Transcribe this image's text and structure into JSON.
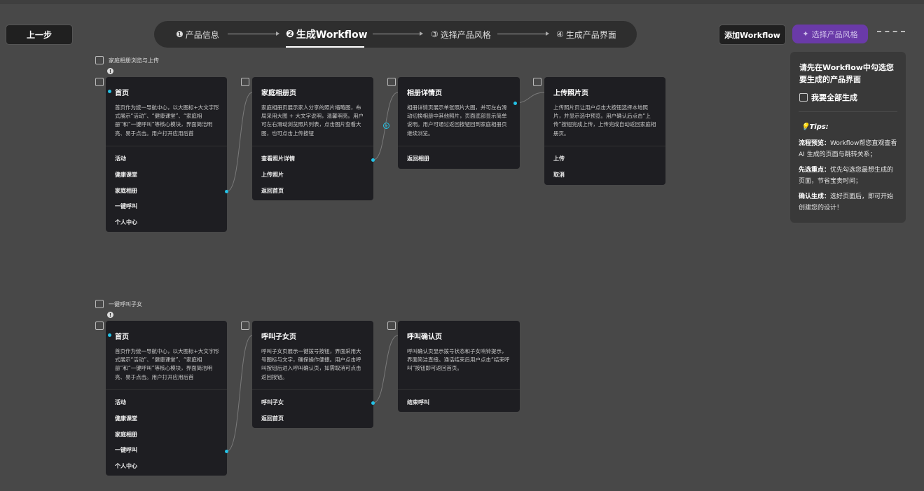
{
  "header": {
    "back_label": "上一步",
    "steps": [
      {
        "num": "❶",
        "label": "产品信息"
      },
      {
        "num": "❷",
        "label": "生成Workflow"
      },
      {
        "num": "③",
        "label": "选择产品风格"
      },
      {
        "num": "④",
        "label": "生成产品界面"
      }
    ],
    "add_workflow_label": "添加Workflow",
    "select_style_label": "选择产品风格",
    "select_style_icon": "sparkle-icon"
  },
  "groups": [
    {
      "label": "家庭相册浏览与上传",
      "cards": [
        {
          "title": "首页",
          "desc": "首页作为统一导航中心，以大图标+大文字形式展示“活动”、“健康课堂”、“家庭相册”和“一键呼叫”等核心模块，界面简洁明亮、易于点击。用户打开应用后首",
          "actions": [
            "活动",
            "健康课堂",
            "家庭相册",
            "一键呼叫",
            "个人中心"
          ]
        },
        {
          "title": "家庭相册页",
          "desc": "家庭相册页展示家人分享的照片缩略图，布局采用大图 + 大文字说明，温馨明亮。用户可左右滑动浏览照片列表，点击图片查看大图，也可点击上传按钮",
          "actions": [
            "查看照片详情",
            "上传照片",
            "返回首页"
          ]
        },
        {
          "title": "相册详情页",
          "desc": "相册详情页展示单张照片大图，并可左右滑动切换相册中其他照片，页面底部显示简单说明。用户可通过返回按钮回到家庭相册页继续浏览。",
          "actions": [
            "返回相册"
          ]
        },
        {
          "title": "上传照片页",
          "desc": "上传照片页让用户点击大按钮选择本地照片，并显示选中预览。用户确认后点击“上传”按钮完成上传，上传完成自动返回家庭相册页。",
          "actions": [
            "上传",
            "取消"
          ]
        }
      ]
    },
    {
      "label": "一键呼叫子女",
      "cards": [
        {
          "title": "首页",
          "desc": "首页作为统一导航中心，以大图标+大文字形式展示“活动”、“健康课堂”、“家庭相册”和“一键呼叫”等核心模块，界面简洁明亮、易于点击。用户打开应用后首",
          "actions": [
            "活动",
            "健康课堂",
            "家庭相册",
            "一键呼叫",
            "个人中心"
          ]
        },
        {
          "title": "呼叫子女页",
          "desc": "呼叫子女页展示一键拨号按钮，界面采用大号图标与文字，确保操作便捷。用户点击呼叫按钮后进入呼叫确认页，如需取消可点击返回按钮。",
          "actions": [
            "呼叫子女",
            "返回首页"
          ]
        },
        {
          "title": "呼叫确认页",
          "desc": "呼叫确认页显示拨号状态和子女响铃提示，界面简洁直接。通话结束后用户点击“结束呼叫”按钮即可返回首页。",
          "actions": [
            "结束呼叫"
          ]
        }
      ]
    }
  ],
  "panel": {
    "title": "请先在Workflow中勾选您要生成的产品界面",
    "generate_all_label": "我要全部生成",
    "tips_title": "💡Tips:",
    "tips": [
      {
        "head": "流程预览：",
        "text": "Workflow帮您直观查看 AI 生成的页面与跳转关系；"
      },
      {
        "head": "先选重点：",
        "text": "优先勾选您最想生成的页面，节省宝贵时间；"
      },
      {
        "head": "确认生成：",
        "text": "选好页面后，即可开始创建您的设计！"
      }
    ]
  },
  "colors": {
    "accent": "#23c2e6",
    "brand": "#6a3aa8",
    "card": "#1e1e22",
    "background": "#484848"
  }
}
